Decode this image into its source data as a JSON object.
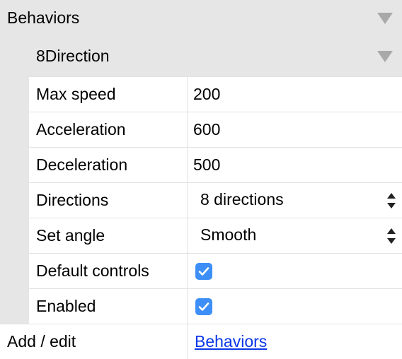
{
  "section": {
    "label": "Behaviors",
    "collapse_icon": "triangle-down-icon"
  },
  "behavior": {
    "label": "8Direction",
    "collapse_icon": "triangle-down-icon"
  },
  "properties": [
    {
      "name": "Max speed",
      "value": "200"
    },
    {
      "name": "Acceleration",
      "value": "600"
    },
    {
      "name": "Deceleration",
      "value": "500"
    },
    {
      "name": "Directions",
      "value": "8 directions",
      "control": "select"
    },
    {
      "name": "Set angle",
      "value": "Smooth",
      "control": "select"
    },
    {
      "name": "Default controls",
      "checked": true,
      "control": "checkbox"
    },
    {
      "name": "Enabled",
      "checked": true,
      "control": "checkbox"
    }
  ],
  "footer": {
    "name": "Add / edit",
    "link": "Behaviors"
  },
  "colors": {
    "checkbox": "#3d8ff7",
    "link": "#0a37e8",
    "header_bg": "#e6e6e6"
  }
}
